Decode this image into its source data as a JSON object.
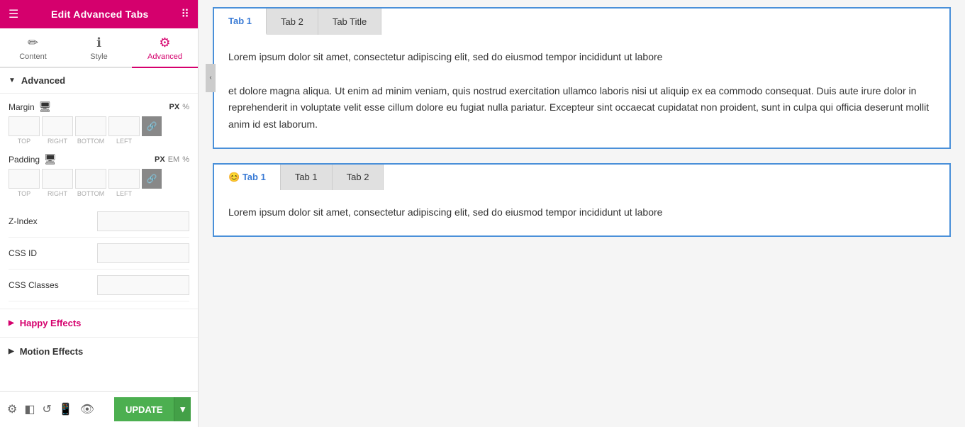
{
  "header": {
    "title": "Edit Advanced Tabs",
    "hamburger": "☰",
    "grid": "⠿"
  },
  "tabs": [
    {
      "id": "content",
      "label": "Content",
      "icon": "✏"
    },
    {
      "id": "style",
      "label": "Style",
      "icon": "ℹ"
    },
    {
      "id": "advanced",
      "label": "Advanced",
      "icon": "⚙",
      "active": true
    }
  ],
  "advanced_section": {
    "label": "Advanced"
  },
  "margin": {
    "label": "Margin",
    "units": [
      "PX",
      "%"
    ],
    "active_unit": "PX",
    "top": "",
    "right": "",
    "bottom": "",
    "left": ""
  },
  "padding": {
    "label": "Padding",
    "units": [
      "PX",
      "EM",
      "%"
    ],
    "active_unit": "PX",
    "top": "",
    "right": "",
    "bottom": "",
    "left": ""
  },
  "zindex": {
    "label": "Z-Index",
    "value": ""
  },
  "css_id": {
    "label": "CSS ID",
    "value": ""
  },
  "css_classes": {
    "label": "CSS Classes",
    "value": ""
  },
  "happy_effects": {
    "label": "Happy Effects"
  },
  "motion_effects": {
    "label": "Motion Effects"
  },
  "bottom_bar": {
    "update_label": "UPDATE",
    "arrow_label": "▾"
  },
  "tab_widget_1": {
    "tabs": [
      {
        "id": "tab1",
        "label": "Tab 1",
        "active": true
      },
      {
        "id": "tab2",
        "label": "Tab 2"
      },
      {
        "id": "tab_title",
        "label": "Tab Title"
      }
    ],
    "content": "Lorem ipsum dolor sit amet, consectetur adipiscing elit, sed do eiusmod tempor incididunt ut labore\n\net dolore magna aliqua. Ut enim ad minim veniam, quis nostrud exercitation ullamco laboris nisi ut aliquip ex ea commodo consequat. Duis aute irure dolor in reprehenderit in voluptate velit esse cillum dolore eu fugiat nulla pariatur. Excepteur sint occaecat cupidatat non proident, sunt in culpa qui officia deserunt mollit anim id est laborum."
  },
  "tab_widget_2": {
    "tabs": [
      {
        "id": "tab1",
        "label": "Tab 1",
        "active": true,
        "emoji": "😊"
      },
      {
        "id": "tab1b",
        "label": "Tab 1"
      },
      {
        "id": "tab2",
        "label": "Tab 2"
      }
    ],
    "content": "Lorem ipsum dolor sit amet, consectetur adipiscing elit, sed do eiusmod tempor incididunt ut labore"
  },
  "field_labels": {
    "top": "TOP",
    "right": "RIGHT",
    "bottom": "BOTTOM",
    "left": "LEFT"
  }
}
